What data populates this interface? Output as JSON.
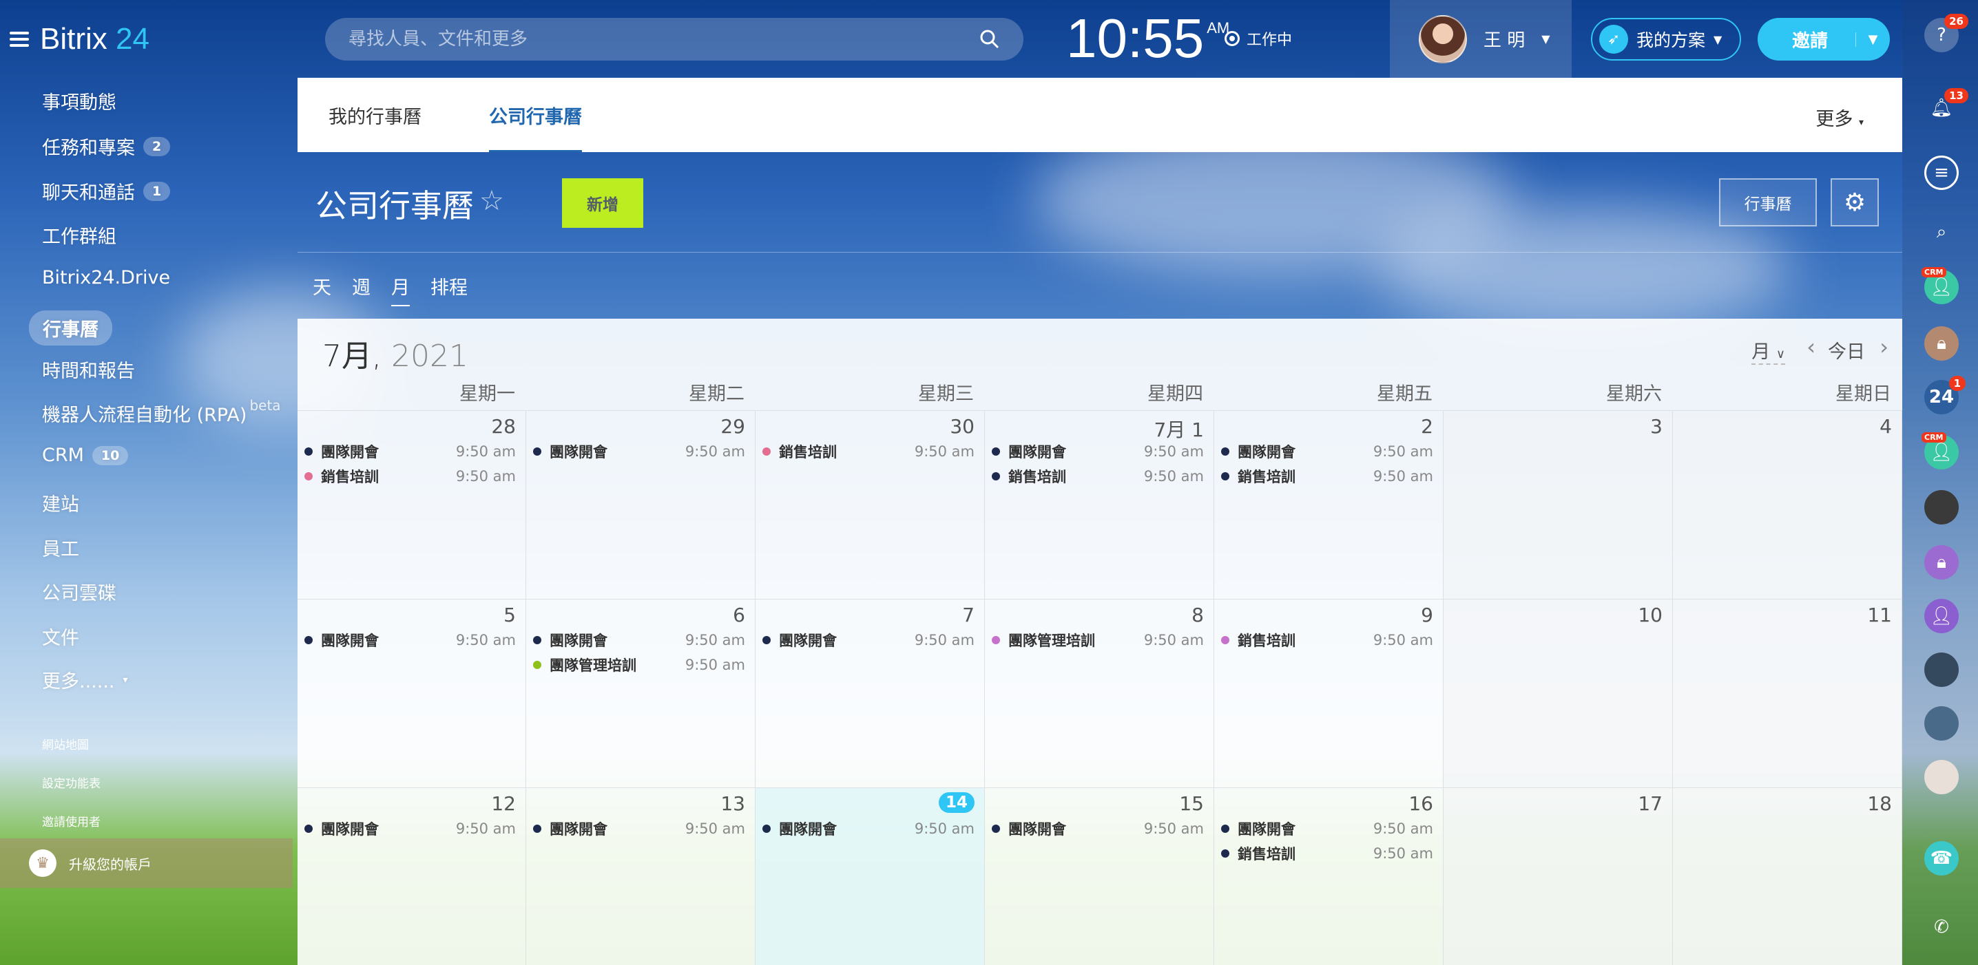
{
  "app": {
    "logo_text": "Bitrix",
    "logo_num": "24"
  },
  "search": {
    "placeholder": "尋找人員、文件和更多"
  },
  "clock": {
    "time": "10:55",
    "ampm": "AM",
    "status": "工作中"
  },
  "user": {
    "name": "王 明"
  },
  "header": {
    "my_plan": "我的方案",
    "invite": "邀請"
  },
  "sidebar": {
    "items": [
      {
        "label": "事項動態"
      },
      {
        "label": "任務和專案",
        "count": "2"
      },
      {
        "label": "聊天和通話",
        "count": "1"
      },
      {
        "label": "工作群組"
      },
      {
        "label": "Bitrix24.Drive"
      },
      {
        "label": "行事曆"
      },
      {
        "label": "時間和報告"
      },
      {
        "label": "機器人流程自動化 (RPA)",
        "sup": "beta"
      },
      {
        "label": "CRM",
        "count": "10"
      },
      {
        "label": "建站"
      },
      {
        "label": "員工"
      },
      {
        "label": "公司雲碟"
      },
      {
        "label": "文件"
      },
      {
        "label": "更多......"
      }
    ],
    "small": [
      "網站地圖",
      "設定功能表",
      "邀請使用者"
    ],
    "upgrade": "升級您的帳戶"
  },
  "tabs": {
    "my_calendar": "我的行事曆",
    "company_calendar": "公司行事曆",
    "more": "更多"
  },
  "page": {
    "title": "公司行事曆",
    "add": "新增",
    "calendar_btn": "行事曆"
  },
  "views": {
    "day": "天",
    "week": "週",
    "month": "月",
    "schedule": "排程"
  },
  "calendar": {
    "month": "7月,",
    "year": "2021",
    "mode": "月",
    "today": "今日",
    "weekdays": [
      "星期一",
      "星期二",
      "星期三",
      "星期四",
      "星期五",
      "星期六",
      "星期日"
    ],
    "weeks": [
      {
        "days": [
          {
            "num": "28",
            "events": [
              {
                "t": "團隊開會",
                "tm": "9:50 am",
                "c": "#1d2a4d"
              },
              {
                "t": "銷售培訓",
                "tm": "9:50 am",
                "c": "#e46e8f"
              }
            ]
          },
          {
            "num": "29",
            "events": [
              {
                "t": "團隊開會",
                "tm": "9:50 am",
                "c": "#1d2a4d"
              }
            ]
          },
          {
            "num": "30",
            "events": [
              {
                "t": "銷售培訓",
                "tm": "9:50 am",
                "c": "#e46e8f"
              }
            ]
          },
          {
            "num": "7月 1",
            "events": [
              {
                "t": "團隊開會",
                "tm": "9:50 am",
                "c": "#1d2a4d"
              },
              {
                "t": "銷售培訓",
                "tm": "9:50 am",
                "c": "#1d2a4d"
              }
            ]
          },
          {
            "num": "2",
            "events": [
              {
                "t": "團隊開會",
                "tm": "9:50 am",
                "c": "#1d2a4d"
              },
              {
                "t": "銷售培訓",
                "tm": "9:50 am",
                "c": "#1d2a4d"
              }
            ]
          },
          {
            "num": "3",
            "events": []
          },
          {
            "num": "4",
            "events": []
          }
        ]
      },
      {
        "days": [
          {
            "num": "5",
            "events": [
              {
                "t": "團隊開會",
                "tm": "9:50 am",
                "c": "#1d2a4d"
              }
            ]
          },
          {
            "num": "6",
            "events": [
              {
                "t": "團隊開會",
                "tm": "9:50 am",
                "c": "#1d2a4d"
              },
              {
                "t": "團隊管理培訓",
                "tm": "9:50 am",
                "c": "#8ec21a"
              }
            ]
          },
          {
            "num": "7",
            "events": [
              {
                "t": "團隊開會",
                "tm": "9:50 am",
                "c": "#1d2a4d"
              }
            ]
          },
          {
            "num": "8",
            "events": [
              {
                "t": "團隊管理培訓",
                "tm": "9:50 am",
                "c": "#c672cc"
              }
            ]
          },
          {
            "num": "9",
            "events": [
              {
                "t": "銷售培訓",
                "tm": "9:50 am",
                "c": "#c672cc"
              }
            ]
          },
          {
            "num": "10",
            "events": []
          },
          {
            "num": "11",
            "events": []
          }
        ]
      },
      {
        "days": [
          {
            "num": "12",
            "events": [
              {
                "t": "團隊開會",
                "tm": "9:50 am",
                "c": "#1d2a4d"
              }
            ]
          },
          {
            "num": "13",
            "events": [
              {
                "t": "團隊開會",
                "tm": "9:50 am",
                "c": "#1d2a4d"
              }
            ]
          },
          {
            "num": "14",
            "today": true,
            "events": [
              {
                "t": "團隊開會",
                "tm": "9:50 am",
                "c": "#1d2a4d"
              }
            ]
          },
          {
            "num": "15",
            "events": [
              {
                "t": "團隊開會",
                "tm": "9:50 am",
                "c": "#1d2a4d"
              }
            ]
          },
          {
            "num": "16",
            "events": [
              {
                "t": "團隊開會",
                "tm": "9:50 am",
                "c": "#1d2a4d"
              },
              {
                "t": "銷售培訓",
                "tm": "9:50 am",
                "c": "#1d2a4d"
              }
            ]
          },
          {
            "num": "17",
            "events": []
          },
          {
            "num": "18",
            "events": []
          }
        ]
      }
    ]
  },
  "rail": {
    "help_badge": "26",
    "notif_badge": "13",
    "b24_badge": "1",
    "crm_tag": "CRM",
    "b24_label": "24"
  },
  "colors": {
    "accent": "#2fc6f6",
    "add_button": "#bbed21",
    "active_tab": "#2067b0"
  }
}
